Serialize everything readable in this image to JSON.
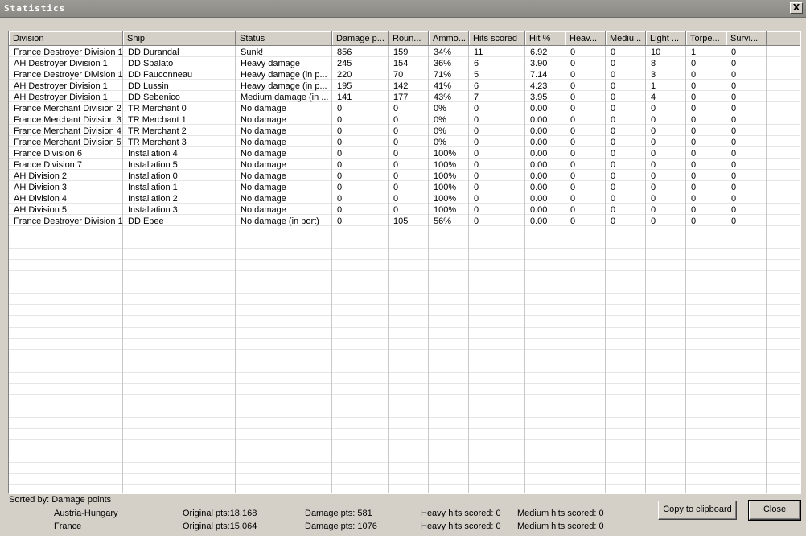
{
  "window": {
    "title": "Statistics",
    "close_label": "X"
  },
  "table": {
    "columns": [
      "Division",
      "Ship",
      "Status",
      "Damage p...",
      "Roun...",
      "Ammo...",
      "Hits scored",
      "Hit %",
      "Heav...",
      "Mediu...",
      "Light ...",
      "Torpe...",
      "Survi..."
    ],
    "rows": [
      [
        "France Destroyer Division 1",
        "DD Durandal",
        "Sunk!",
        "856",
        "159",
        "34%",
        "11",
        "6.92",
        "0",
        "0",
        "10",
        "1",
        "0"
      ],
      [
        "AH Destroyer Division 1",
        "DD Spalato",
        "Heavy damage",
        "245",
        "154",
        "36%",
        "6",
        "3.90",
        "0",
        "0",
        "8",
        "0",
        "0"
      ],
      [
        "France Destroyer Division 1",
        "DD Fauconneau",
        "Heavy damage (in p...",
        "220",
        "70",
        "71%",
        "5",
        "7.14",
        "0",
        "0",
        "3",
        "0",
        "0"
      ],
      [
        "AH Destroyer Division 1",
        "DD Lussin",
        "Heavy damage (in p...",
        "195",
        "142",
        "41%",
        "6",
        "4.23",
        "0",
        "0",
        "1",
        "0",
        "0"
      ],
      [
        "AH Destroyer Division 1",
        "DD Sebenico",
        "Medium damage (in ...",
        "141",
        "177",
        "43%",
        "7",
        "3.95",
        "0",
        "0",
        "4",
        "0",
        "0"
      ],
      [
        "France Merchant Division 2",
        "TR Merchant 0",
        "No damage",
        "0",
        "0",
        "0%",
        "0",
        "0.00",
        "0",
        "0",
        "0",
        "0",
        "0"
      ],
      [
        "France Merchant Division 3",
        "TR Merchant 1",
        "No damage",
        "0",
        "0",
        "0%",
        "0",
        "0.00",
        "0",
        "0",
        "0",
        "0",
        "0"
      ],
      [
        "France Merchant Division 4",
        "TR Merchant 2",
        "No damage",
        "0",
        "0",
        "0%",
        "0",
        "0.00",
        "0",
        "0",
        "0",
        "0",
        "0"
      ],
      [
        "France Merchant Division 5",
        "TR Merchant 3",
        "No damage",
        "0",
        "0",
        "0%",
        "0",
        "0.00",
        "0",
        "0",
        "0",
        "0",
        "0"
      ],
      [
        "France  Division 6",
        "Installation 4",
        "No damage",
        "0",
        "0",
        "100%",
        "0",
        "0.00",
        "0",
        "0",
        "0",
        "0",
        "0"
      ],
      [
        "France  Division 7",
        "Installation 5",
        "No damage",
        "0",
        "0",
        "100%",
        "0",
        "0.00",
        "0",
        "0",
        "0",
        "0",
        "0"
      ],
      [
        "AH  Division 2",
        "Installation 0",
        "No damage",
        "0",
        "0",
        "100%",
        "0",
        "0.00",
        "0",
        "0",
        "0",
        "0",
        "0"
      ],
      [
        "AH  Division 3",
        "Installation 1",
        "No damage",
        "0",
        "0",
        "100%",
        "0",
        "0.00",
        "0",
        "0",
        "0",
        "0",
        "0"
      ],
      [
        "AH  Division 4",
        "Installation 2",
        "No damage",
        "0",
        "0",
        "100%",
        "0",
        "0.00",
        "0",
        "0",
        "0",
        "0",
        "0"
      ],
      [
        "AH  Division 5",
        "Installation 3",
        "No damage",
        "0",
        "0",
        "100%",
        "0",
        "0.00",
        "0",
        "0",
        "0",
        "0",
        "0"
      ],
      [
        "France Destroyer Division 1",
        "DD Epee",
        "No damage (in port)",
        "0",
        "105",
        "56%",
        "0",
        "0.00",
        "0",
        "0",
        "0",
        "0",
        "0"
      ]
    ]
  },
  "footer": {
    "sorted_by": "Sorted by: Damage points",
    "sides": [
      {
        "name": "Austria-Hungary",
        "original": "Original pts:18,168",
        "damage": "Damage pts:  581",
        "heavy": "Heavy hits scored: 0",
        "medium": "Medium hits scored: 0"
      },
      {
        "name": "France",
        "original": "Original pts:15,064",
        "damage": "Damage pts:  1076",
        "heavy": "Heavy hits scored: 0",
        "medium": "Medium hits scored: 0"
      }
    ],
    "copy_label": "Copy to clipboard",
    "close_label": "Close"
  }
}
